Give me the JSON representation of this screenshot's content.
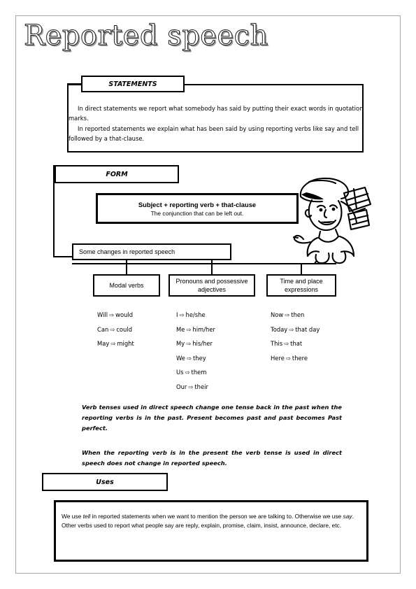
{
  "page": {
    "title": "Reported speech"
  },
  "statements": {
    "label": "STATEMENTS",
    "paragraph_1": "In direct statements we report what somebody has said by putting their exact words in quotation marks.",
    "paragraph_2": "In reported statements we explain what has been said by using reporting verbs like say and tell followed by a that-clause."
  },
  "form": {
    "label": "FORM",
    "formula": "Subject + reporting verb + that-clause",
    "formula_note": "The conjunction that can be left out.",
    "changes_label": "Some changes in reported speech",
    "categories": [
      {
        "label": "Modal verbs"
      },
      {
        "label": "Pronouns and possessive adjectives"
      },
      {
        "label": "Time and place expressions"
      }
    ],
    "columns": [
      {
        "items": [
          {
            "from": "Will",
            "arrow": "⇨",
            "to": "would"
          },
          {
            "from": "Can",
            "arrow": "⇨",
            "to": "could"
          },
          {
            "from": "May",
            "arrow": "⇨",
            "to": "might"
          }
        ]
      },
      {
        "items": [
          {
            "from": "I",
            "arrow": "⇨",
            "to": "he/she"
          },
          {
            "from": "Me",
            "arrow": "⇨",
            "to": "him/her"
          },
          {
            "from": "My",
            "arrow": "⇨",
            "to": "his/her"
          },
          {
            "from": "We",
            "arrow": "⇨",
            "to": "they"
          },
          {
            "from": "Us",
            "arrow": "⇨",
            "to": "them"
          },
          {
            "from": "Our",
            "arrow": "⇨",
            "to": "their"
          }
        ]
      },
      {
        "items": [
          {
            "from": "Now",
            "arrow": "⇨",
            "to": "then"
          },
          {
            "from": "Today",
            "arrow": "⇨",
            "to": "that day"
          },
          {
            "from": "This",
            "arrow": "⇨",
            "to": "that"
          },
          {
            "from": "Here",
            "arrow": "⇨",
            "to": "there"
          }
        ]
      }
    ]
  },
  "notes": {
    "note_1": "Verb tenses used in direct speech change one tense back in the past when the reporting verbs is in the past. Present becomes past and past becomes Past perfect.",
    "note_2": "When the reporting verb is in the present the verb tense is used in direct speech does not change in reported speech."
  },
  "uses": {
    "label": "Uses",
    "line_1_a": "We use ",
    "line_1_em": "tell",
    "line_1_b": " in reported statements when we want to mention the person we are talking to. Otherwise we use ",
    "line_1_em2": "say",
    "line_1_c": ".",
    "line_2": "Other verbs used to report what people say are reply, explain, promise, claim, insist, announce, declare, etc."
  },
  "clipart": {
    "name": "cartoon-boy-illustration"
  }
}
